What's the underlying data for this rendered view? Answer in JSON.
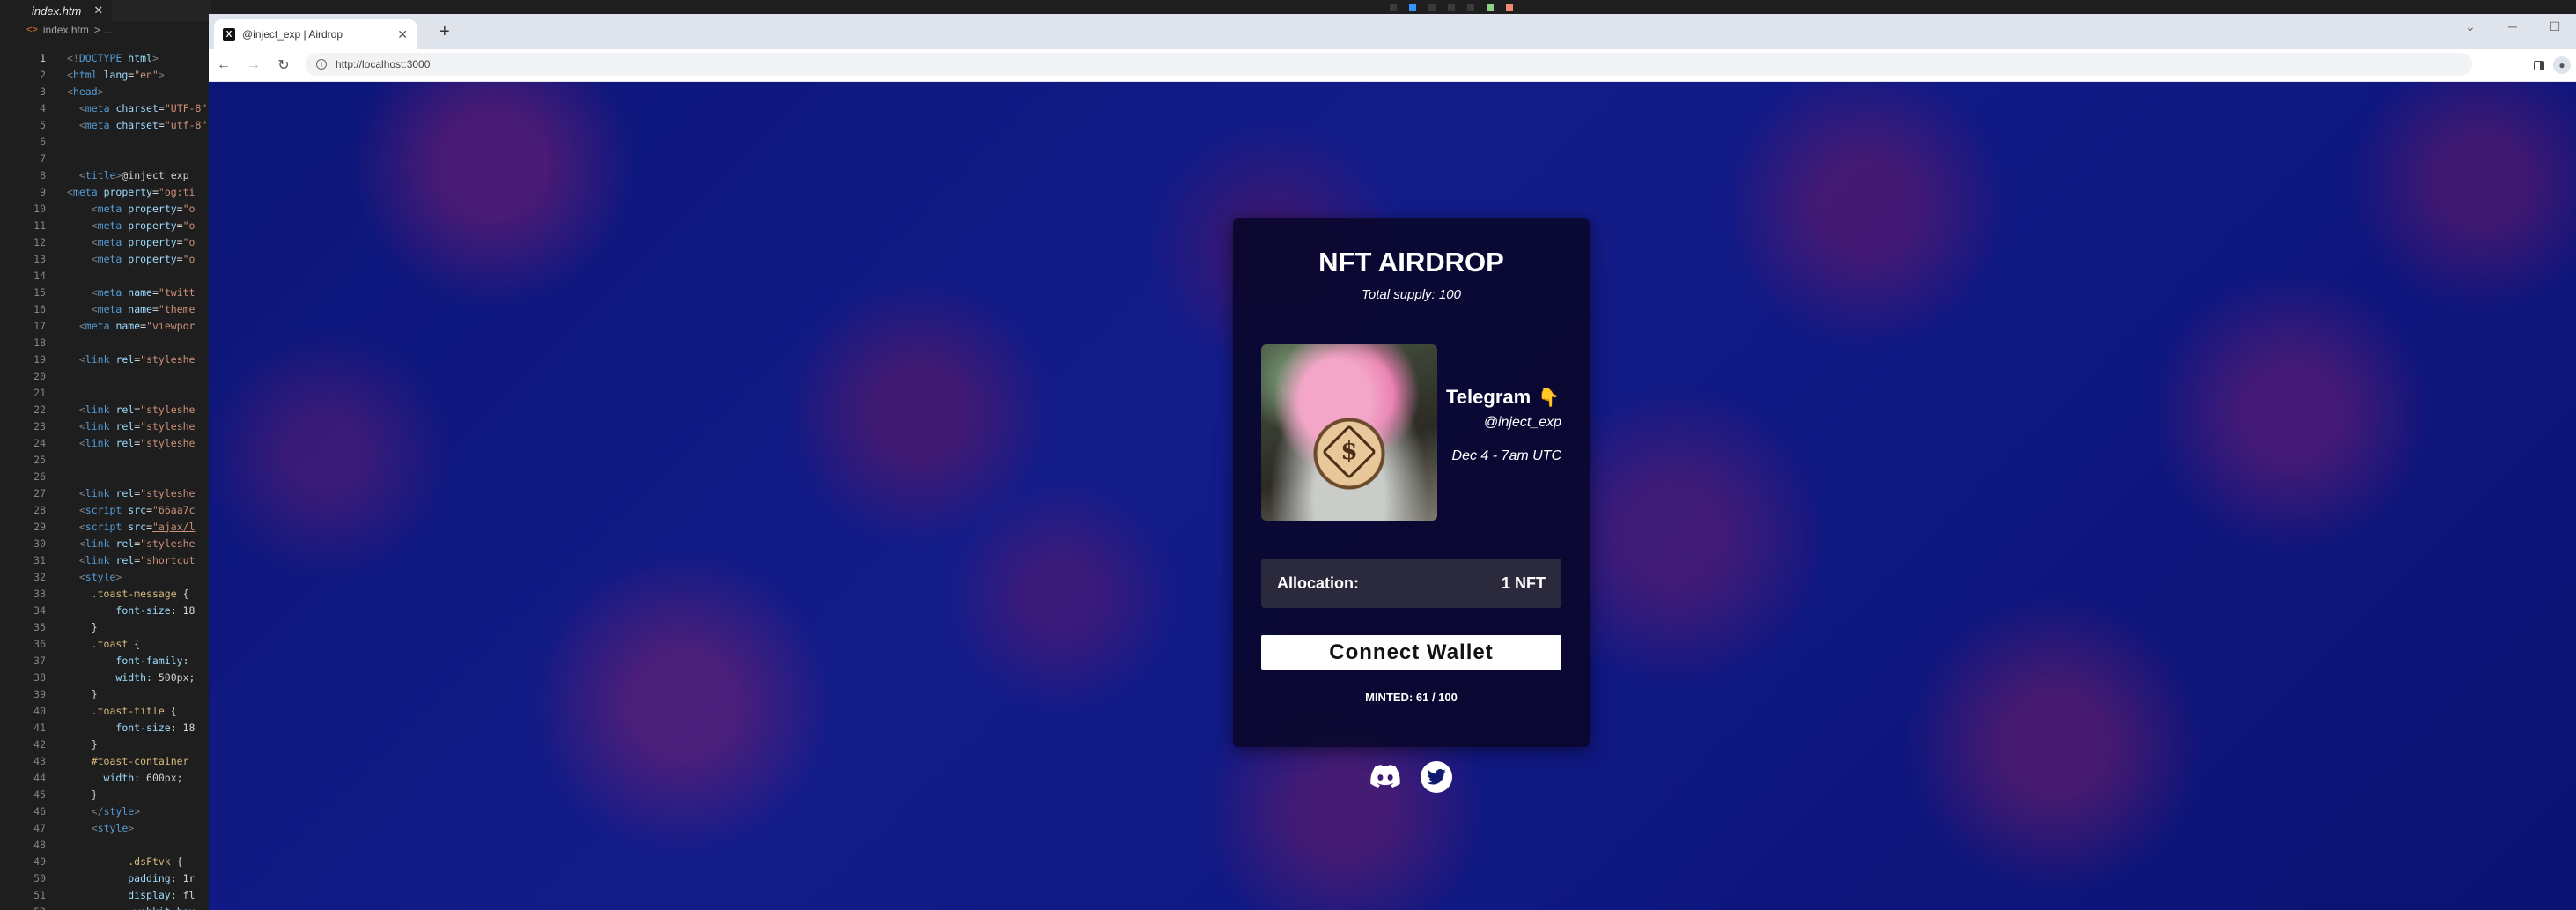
{
  "editor": {
    "tab_name": "index.htm",
    "tab_close": "✕",
    "breadcrumb_file": "index.htm",
    "breadcrumb_tail": "> ..."
  },
  "browser": {
    "tab_title": "@inject_exp | Airdrop",
    "favicon_letter": "X",
    "tab_close": "✕",
    "new_tab": "+",
    "back": "←",
    "forward": "→",
    "reload": "↻",
    "url": "http://localhost:3000",
    "win_min": "─",
    "win_max": "☐",
    "win_chevron": "⌄"
  },
  "card": {
    "title": "NFT AIRDROP",
    "subtitle": "Total supply: 100",
    "telegram_label": "Telegram",
    "telegram_emoji": "👇",
    "handle": "@inject_exp",
    "date": "Dec 4 - 7am UTC",
    "allocation_label": "Allocation:",
    "allocation_value": "1 NFT",
    "connect_label": "Connect Wallet",
    "minted": "MINTED: 61 / 100"
  },
  "colors": {
    "page_bg": "#0f1780",
    "card_bg": "#0a082d",
    "allocation_bg": "#2b2a3d",
    "button_bg": "#ffffff"
  }
}
